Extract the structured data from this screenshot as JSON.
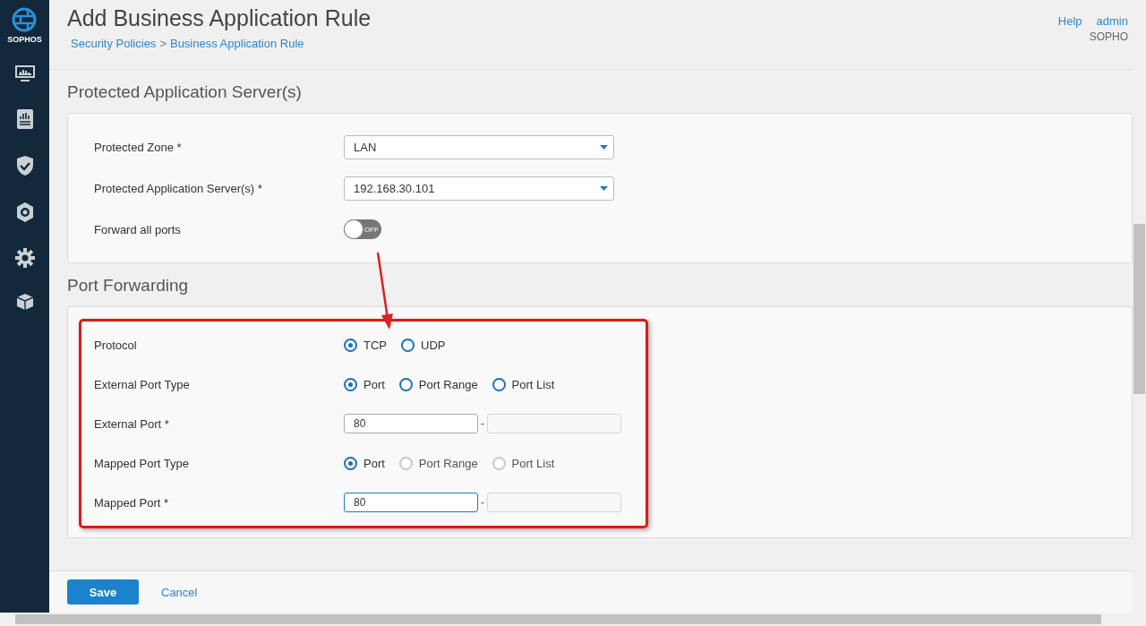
{
  "sidebar": {
    "logo_text": "SOPHOS"
  },
  "header": {
    "title": "Add Business Application Rule",
    "breadcrumb": [
      "Security Policies",
      "Business Application Rule"
    ],
    "breadcrumb_separator": ">",
    "help": "Help",
    "user": "admin",
    "org": "SOPHO"
  },
  "sections": [
    {
      "title": "Protected Application Server(s)",
      "highlighted": false,
      "rows": [
        {
          "kind": "select",
          "label": "Protected Zone *",
          "value": "LAN"
        },
        {
          "kind": "select",
          "label": "Protected Application Server(s) *",
          "value": "192.168.30.101"
        },
        {
          "kind": "toggle",
          "label": "Forward all ports",
          "on": false,
          "text": "OFF"
        }
      ]
    },
    {
      "title": "Port Forwarding",
      "highlighted": true,
      "rows": [
        {
          "kind": "radio",
          "label": "Protocol",
          "options": [
            {
              "label": "TCP",
              "selected": true,
              "disabled": false
            },
            {
              "label": "UDP",
              "selected": false,
              "disabled": false
            }
          ]
        },
        {
          "kind": "radio",
          "label": "External Port Type",
          "options": [
            {
              "label": "Port",
              "selected": true,
              "disabled": false
            },
            {
              "label": "Port Range",
              "selected": false,
              "disabled": false
            },
            {
              "label": "Port List",
              "selected": false,
              "disabled": false
            }
          ]
        },
        {
          "kind": "range",
          "label": "External Port *",
          "from": "80",
          "separator": "-",
          "focused": false
        },
        {
          "kind": "radio",
          "label": "Mapped Port Type",
          "options": [
            {
              "label": "Port",
              "selected": true,
              "disabled": false
            },
            {
              "label": "Port Range",
              "selected": false,
              "disabled": true
            },
            {
              "label": "Port List",
              "selected": false,
              "disabled": true
            }
          ]
        },
        {
          "kind": "range",
          "label": "Mapped Port *",
          "from": "80",
          "separator": "-",
          "focused": true
        }
      ]
    }
  ],
  "buttons": {
    "save": "Save",
    "cancel": "Cancel"
  }
}
